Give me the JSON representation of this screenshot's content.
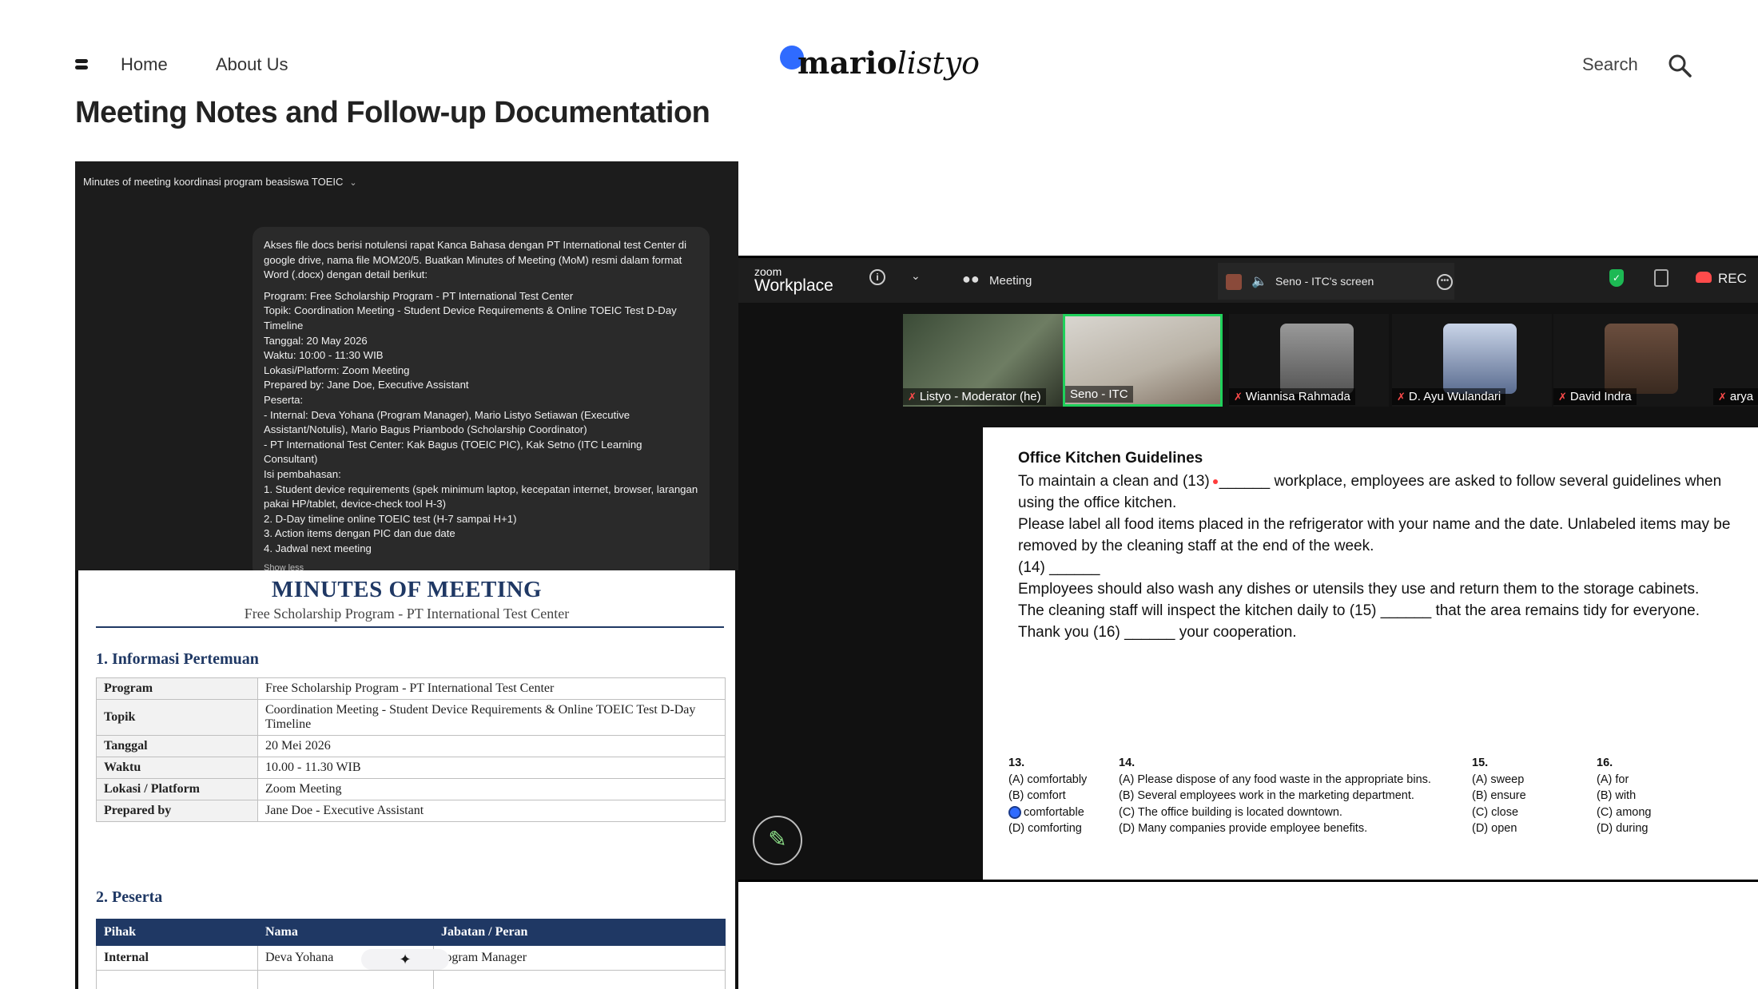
{
  "header": {
    "nav": {
      "home": "Home",
      "about": "About Us"
    },
    "logo": {
      "bold": "mario",
      "italic": "listyo"
    },
    "search_label": "Search",
    "brand_color": "#2f6bff"
  },
  "page_title": "Meeting Notes and Follow-up Documentation",
  "chat": {
    "title": "Minutes of meeting koordinasi program beasiswa TOEIC",
    "intro": "Akses file docs berisi notulensi rapat Kanca Bahasa dengan PT International test Center di google drive, nama file MOM20/5. Buatkan Minutes of Meeting (MoM) resmi dalam format Word (.docx) dengan detail berikut:",
    "lines": [
      "Program: Free Scholarship Program - PT International Test Center",
      "Topik: Coordination Meeting - Student Device Requirements & Online TOEIC Test D-Day Timeline",
      "Tanggal: 20 May 2026",
      "Waktu: 10:00 - 11:30 WIB",
      "Lokasi/Platform: Zoom Meeting",
      "Prepared by: Jane Doe, Executive Assistant",
      "Peserta:",
      "- Internal: Deva Yohana (Program Manager), Mario Listyo Setiawan (Executive Assistant/Notulis), Mario Bagus Priambodo (Scholarship Coordinator)",
      "- PT International Test Center: Kak Bagus (TOEIC PIC), Kak Setno (ITC Learning Consultant)",
      "Isi pembahasan:",
      "1. Student device requirements (spek minimum laptop, kecepatan internet, browser, larangan pakai HP/tablet, device-check tool H-3)",
      "2. D-Day timeline online TOEIC test (H-7 sampai H+1)",
      "3. Action items dengan PIC dan due date",
      "4. Jadwal next meeting"
    ],
    "show_less": "Show less"
  },
  "mom": {
    "title": "MINUTES OF MEETING",
    "subtitle": "Free Scholarship Program - PT International Test Center",
    "section1": "1. Informasi Pertemuan",
    "info": [
      {
        "key": "Program",
        "value": "Free Scholarship Program - PT International Test Center"
      },
      {
        "key": "Topik",
        "value": "Coordination Meeting - Student Device Requirements & Online TOEIC Test D-Day Timeline"
      },
      {
        "key": "Tanggal",
        "value": "20 Mei 2026"
      },
      {
        "key": "Waktu",
        "value": "10.00 - 11.30 WIB"
      },
      {
        "key": "Lokasi / Platform",
        "value": "Zoom Meeting"
      },
      {
        "key": "Prepared by",
        "value": "Jane Doe - Executive Assistant"
      }
    ],
    "section2": "2. Peserta",
    "peserta_headers": [
      "Pihak",
      "Nama",
      "Jabatan / Peran"
    ],
    "peserta_rows": [
      {
        "pihak": "Internal",
        "nama": "Deva Yohana",
        "peran": "rogram Manager"
      }
    ],
    "accent_color": "#1f3864"
  },
  "zoom": {
    "brand_small": "zoom",
    "brand_large": "Workplace",
    "meeting_label": "Meeting",
    "share_label": "Seno - ITC's screen",
    "rec_label": "REC",
    "participants": [
      "Listyo - Moderator (he)",
      "Seno - ITC",
      "Wiannisa Rahmada",
      "D. Ayu Wulandari",
      "David Indra",
      "arya"
    ],
    "active_color": "#1fd15b",
    "slide": {
      "title": "Office Kitchen Guidelines",
      "line1a": "To maintain a clean and (13)",
      "line1b": "______ workplace, employees are asked to follow several guidelines when using the office kitchen.",
      "line2": "Please label all food items placed in the refrigerator with your name and the date. Unlabeled items may be removed by the cleaning staff at the end of the week.",
      "line3": "(14) ______",
      "line4": "Employees should also wash any dishes or utensils they use and return them to the storage cabinets.",
      "line5": "The cleaning staff will inspect the kitchen daily to (15) ______ that the area remains tidy for everyone.",
      "line6": "Thank you (16) ______ your cooperation.",
      "questions": [
        {
          "num": "13.",
          "options": [
            "(A) comfortably",
            "(B) comfort",
            "comfortable",
            "(D) comforting"
          ]
        },
        {
          "num": "14.",
          "options": [
            "(A) Please dispose of any food waste in the appropriate bins.",
            "(B) Several employees work in the marketing department.",
            "(C) The office building is located downtown.",
            "(D) Many companies provide employee benefits."
          ]
        },
        {
          "num": "15.",
          "options": [
            "(A) sweep",
            "(B) ensure",
            "(C) close",
            "(D) open"
          ]
        },
        {
          "num": "16.",
          "options": [
            "(A) for",
            "(B) with",
            "(C) among",
            "(D) during"
          ]
        }
      ]
    }
  }
}
